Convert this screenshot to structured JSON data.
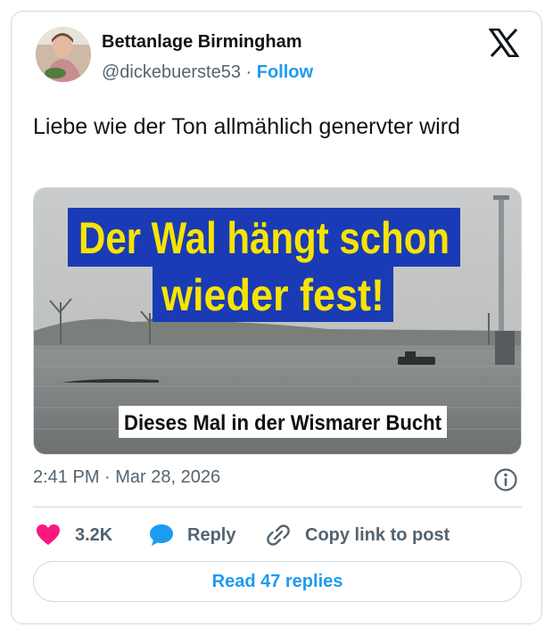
{
  "author": {
    "name": "Bettanlage Birmingham",
    "handle": "@dickebuerste53",
    "separator": "·",
    "follow_label": "Follow"
  },
  "tweet": {
    "text": "Liebe wie der Ton allmählich genervter wird"
  },
  "media": {
    "headline_line1": "Der Wal hängt schon",
    "headline_line2": "wieder fest!",
    "caption": "Dieses Mal in der Wismarer Bucht"
  },
  "meta": {
    "timestamp": "2:41 PM · Mar 28, 2026"
  },
  "actions": {
    "like_count": "3.2K",
    "reply_label": "Reply",
    "copy_link_label": "Copy link to post",
    "read_replies_label": "Read 47 replies"
  },
  "icons": {
    "x_logo": "x-logo-icon",
    "heart": "heart-icon",
    "reply": "speech-bubble-icon",
    "link": "link-icon",
    "info": "info-icon"
  },
  "colors": {
    "accent": "#1d9bf0",
    "like": "#f91880",
    "headline_bg": "#1a3bb5",
    "headline_text": "#f7e400"
  }
}
